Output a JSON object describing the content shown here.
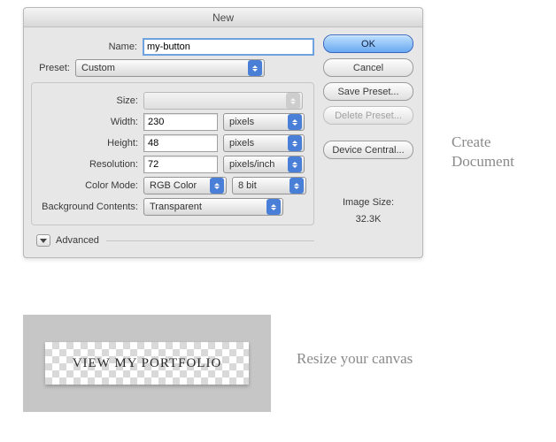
{
  "dialog": {
    "title": "New",
    "name_label": "Name:",
    "name_value": "my-button",
    "preset_label": "Preset:",
    "preset_value": "Custom",
    "size_label": "Size:",
    "size_value": "",
    "width_label": "Width:",
    "width_value": "230",
    "width_unit": "pixels",
    "height_label": "Height:",
    "height_value": "48",
    "height_unit": "pixels",
    "resolution_label": "Resolution:",
    "resolution_value": "72",
    "resolution_unit": "pixels/inch",
    "colormode_label": "Color Mode:",
    "colormode_value": "RGB Color",
    "colordepth_value": "8 bit",
    "bg_label": "Background Contents:",
    "bg_value": "Transparent",
    "advanced_label": "Advanced",
    "imgsize_label": "Image Size:",
    "imgsize_value": "32.3K"
  },
  "buttons": {
    "ok": "OK",
    "cancel": "Cancel",
    "save_preset": "Save Preset...",
    "delete_preset": "Delete Preset...",
    "device_central": "Device Central..."
  },
  "annotations": {
    "create_doc": "Create Document",
    "resize_canvas": "Resize your canvas"
  },
  "canvas": {
    "button_text": "VIEW MY PORTFOLIO"
  }
}
